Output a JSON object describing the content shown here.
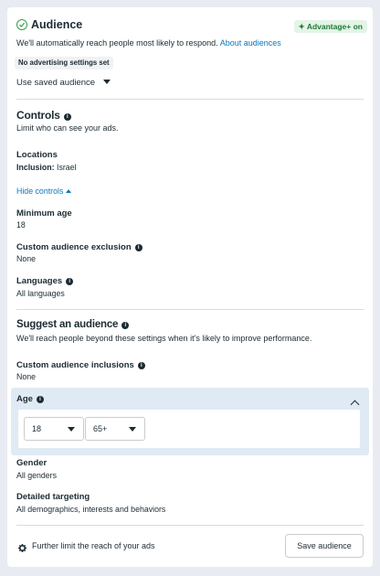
{
  "audience": {
    "title": "Audience",
    "badge": "Advantage+ on",
    "description": "We'll automatically reach people most likely to respond.",
    "link": "About audiences",
    "pill": "No advertising settings set",
    "saved_dropdown": "Use saved audience"
  },
  "controls": {
    "title": "Controls",
    "description": "Limit who can see your ads.",
    "locations_label": "Locations",
    "inclusion_label": "Inclusion:",
    "inclusion_value": "Israel",
    "hide_controls": "Hide controls",
    "min_age_label": "Minimum age",
    "min_age_value": "18",
    "custom_exclusion_label": "Custom audience exclusion",
    "custom_exclusion_value": "None",
    "languages_label": "Languages",
    "languages_value": "All languages"
  },
  "suggest": {
    "title": "Suggest an audience",
    "description": "We'll reach people beyond these settings when it's likely to improve performance.",
    "custom_inclusions_label": "Custom audience inclusions",
    "custom_inclusions_value": "None",
    "age_label": "Age",
    "age_min": "18",
    "age_max": "65+",
    "gender_label": "Gender",
    "gender_value": "All genders",
    "detailed_label": "Detailed targeting",
    "detailed_value": "All demographics, interests and behaviors"
  },
  "footer": {
    "further_limit": "Further limit the reach of your ads",
    "save_button": "Save audience"
  }
}
